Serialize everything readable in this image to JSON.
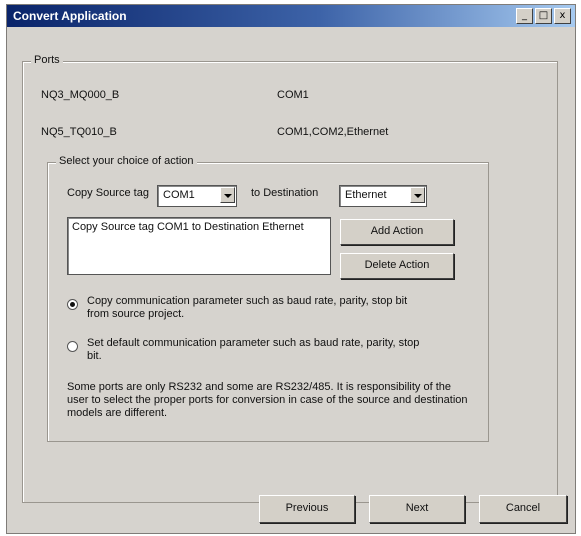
{
  "window": {
    "title": "Convert Application",
    "controls": {
      "minimize": "_",
      "maximize": "□",
      "close": "x"
    }
  },
  "ports": {
    "legend": "Ports",
    "rows": [
      {
        "device": "NQ3_MQ000_B",
        "ports": "COM1"
      },
      {
        "device": "NQ5_TQ010_B",
        "ports": "COM1,COM2,Ethernet"
      }
    ]
  },
  "action": {
    "legend": "Select your choice of action",
    "source_label": "Copy Source tag",
    "source_value": "COM1",
    "dest_label": "to Destination",
    "dest_value": "Ethernet",
    "list_items": [
      "Copy Source tag COM1 to Destination Ethernet"
    ],
    "add_button": "Add Action",
    "delete_button": "Delete Action",
    "option1": "Copy communication parameter such as baud rate, parity, stop bit from source project.",
    "option1_selected": true,
    "option2": "Set default communication parameter such as baud rate, parity, stop bit.",
    "option2_selected": false,
    "note": "Some ports are only RS232 and some are RS232/485. It is responsibility of the user to select the proper ports for conversion in case of the source and destination models are different."
  },
  "footer": {
    "previous": "Previous",
    "next": "Next",
    "cancel": "Cancel"
  }
}
